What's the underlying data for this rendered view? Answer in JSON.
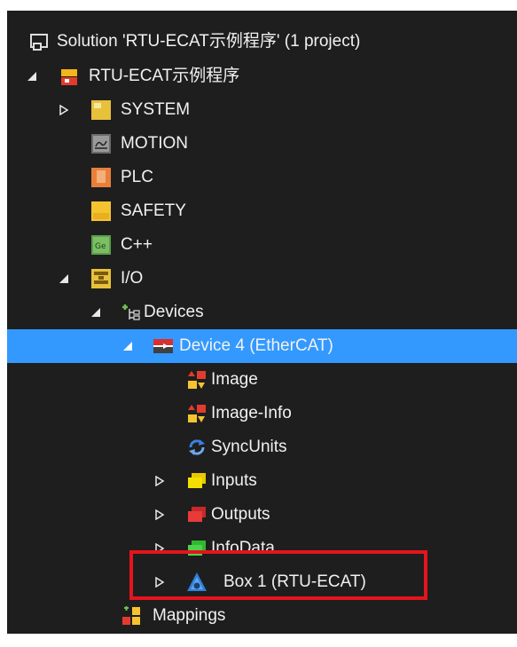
{
  "tree": {
    "solution": "Solution 'RTU-ECAT示例程序' (1 project)",
    "project": "RTU-ECAT示例程序",
    "system": "SYSTEM",
    "motion": "MOTION",
    "plc": "PLC",
    "safety": "SAFETY",
    "cpp": "C++",
    "io": "I/O",
    "devices": "Devices",
    "device4": "Device 4 (EtherCAT)",
    "image": "Image",
    "image_info": "Image-Info",
    "sync_units": "SyncUnits",
    "inputs": "Inputs",
    "outputs": "Outputs",
    "info_data": "InfoData",
    "box1": "Box 1 (RTU-ECAT)",
    "mappings": "Mappings"
  },
  "colors": {
    "panel_bg": "#1e1e1e",
    "selection": "#3399ff",
    "highlight_border": "#e5141b",
    "text": "#f1f1f1"
  }
}
